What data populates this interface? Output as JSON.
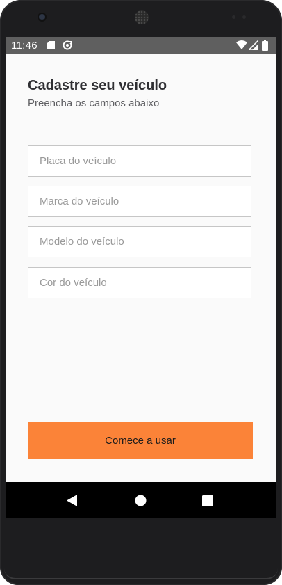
{
  "status_bar": {
    "time": "11:46",
    "icons": [
      "sd-card-icon",
      "sync-icon",
      "wifi-icon",
      "signal-icon",
      "battery-icon"
    ]
  },
  "header": {
    "title": "Cadastre seu veículo",
    "subtitle": "Preencha os campos abaixo"
  },
  "form": {
    "fields": [
      {
        "placeholder": "Placa do veículo",
        "value": ""
      },
      {
        "placeholder": "Marca do veículo",
        "value": ""
      },
      {
        "placeholder": "Modelo do veículo",
        "value": ""
      },
      {
        "placeholder": "Cor do veículo",
        "value": ""
      }
    ],
    "submit_label": "Comece a usar"
  },
  "navigation_bar": {
    "buttons": [
      "back-icon",
      "home-icon",
      "recents-icon"
    ]
  },
  "colors": {
    "accent": "#fb8338",
    "status_bar_bg": "#5f5f5f",
    "screen_bg": "#fafafa",
    "nav_bar_bg": "#000000"
  }
}
